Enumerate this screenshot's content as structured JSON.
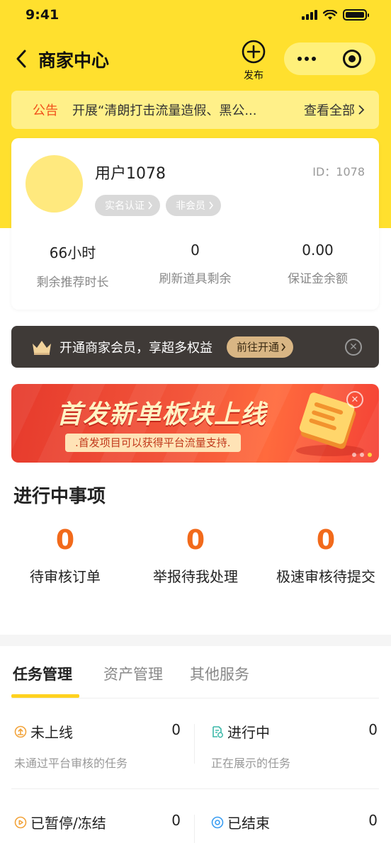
{
  "status_bar": {
    "time": "9:41"
  },
  "nav": {
    "title": "商家中心",
    "publish_label": "发布"
  },
  "notice": {
    "tag": "公告",
    "text": "开展“清朗打击流量造假、黑公...",
    "more": "查看全部"
  },
  "user": {
    "name": "用户1078",
    "id_text": "ID：1078",
    "badges": [
      "实名认证",
      "非会员"
    ],
    "stats": [
      {
        "value": "66小时",
        "label": "剩余推荐时长"
      },
      {
        "value": "0",
        "label": "刷新道具剩余"
      },
      {
        "value": "0.00",
        "label": "保证金余额"
      }
    ]
  },
  "member_banner": {
    "text": "开通商家会员，享超多权益",
    "button": "前往开通"
  },
  "promo": {
    "title": "首发新单板块上线",
    "subtitle": ".首发项目可以获得平台流量支持."
  },
  "in_progress": {
    "title": "进行中事项",
    "items": [
      {
        "count": "0",
        "label": "待审核订单"
      },
      {
        "count": "0",
        "label": "举报待我处理"
      },
      {
        "count": "0",
        "label": "极速审核待提交"
      }
    ]
  },
  "tabs": [
    "任务管理",
    "资产管理",
    "其他服务"
  ],
  "tasks": [
    {
      "title": "未上线",
      "count": "0",
      "desc": "未通过平台审核的任务"
    },
    {
      "title": "进行中",
      "count": "0",
      "desc": "正在展示的任务"
    },
    {
      "title": "已暂停/冻结",
      "count": "0",
      "desc": ""
    },
    {
      "title": "已结束",
      "count": "0",
      "desc": ""
    }
  ],
  "colors": {
    "brand_yellow": "#ffe02e",
    "accent_orange": "#f26a1b",
    "member_gold": "#d9b684"
  }
}
